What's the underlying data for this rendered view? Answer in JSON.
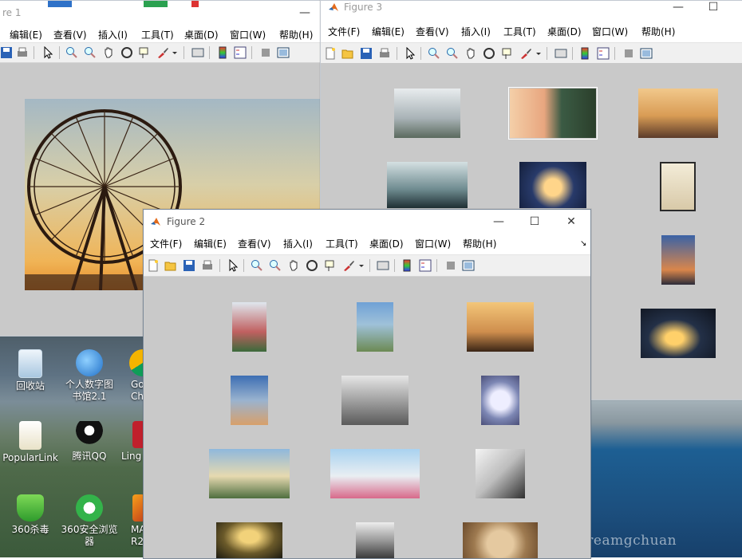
{
  "desktop": {
    "icons": [
      {
        "label": "回收站"
      },
      {
        "label": "个人数字图书馆2.1"
      },
      {
        "label": "Go Ch"
      },
      {
        "label": "PopularLink"
      },
      {
        "label": "腾讯QQ"
      },
      {
        "label": "Ling"
      },
      {
        "label": "360杀毒"
      },
      {
        "label": "360安全浏览器"
      },
      {
        "label": "MA R2"
      }
    ],
    "watermark": "blog.csdn.net/dreamgchuan"
  },
  "figure1": {
    "title": "re 1",
    "menu": [
      "编辑(E)",
      "查看(V)",
      "插入(I)",
      "工具(T)",
      "桌面(D)",
      "窗口(W)",
      "帮助(H)"
    ],
    "minimize": "—"
  },
  "figure3": {
    "title": "Figure 3",
    "menu": [
      "文件(F)",
      "编辑(E)",
      "查看(V)",
      "插入(I)",
      "工具(T)",
      "桌面(D)",
      "窗口(W)",
      "帮助(H)"
    ],
    "minimize": "—",
    "maximize": "☐"
  },
  "figure2": {
    "title": "Figure 2",
    "menu": [
      "文件(F)",
      "编辑(E)",
      "查看(V)",
      "插入(I)",
      "工具(T)",
      "桌面(D)",
      "窗口(W)",
      "帮助(H)"
    ],
    "minimize": "—",
    "maximize": "☐",
    "close": "✕",
    "dock_arrow": "↘"
  },
  "colors": {
    "matlab_canvas": "#c9c9c9",
    "toolbar": "#f0f0f0"
  }
}
